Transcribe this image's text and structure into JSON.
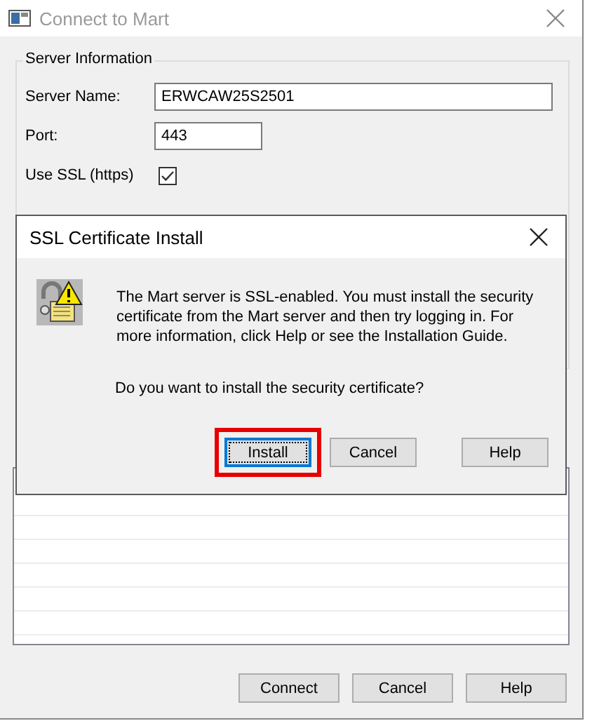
{
  "window": {
    "title": "Connect to Mart"
  },
  "server_information": {
    "title": "Server Information",
    "fields": [
      {
        "label": "Server Name:",
        "value": "ERWCAW25S2501",
        "kind": "wide"
      },
      {
        "label": "Port:",
        "value": "443",
        "kind": "short"
      }
    ],
    "use_ssl": {
      "label": "Use SSL (https)",
      "checked": true
    }
  },
  "buttons": [
    {
      "label": "Connect"
    },
    {
      "label": "Cancel"
    },
    {
      "label": "Help"
    }
  ],
  "dialog": {
    "title": "SSL Certificate Install",
    "message": "The Mart server is SSL-enabled. You must install the security certificate from the Mart server and then try logging in. For more information, click Help or see the Installation Guide.",
    "question": "Do you want to install the security certificate?",
    "buttons": [
      {
        "label": "Install",
        "focused": true,
        "highlighted": true
      },
      {
        "label": "Cancel",
        "focused": false,
        "highlighted": false
      },
      {
        "label": "Help",
        "focused": false,
        "highlighted": false
      }
    ]
  }
}
